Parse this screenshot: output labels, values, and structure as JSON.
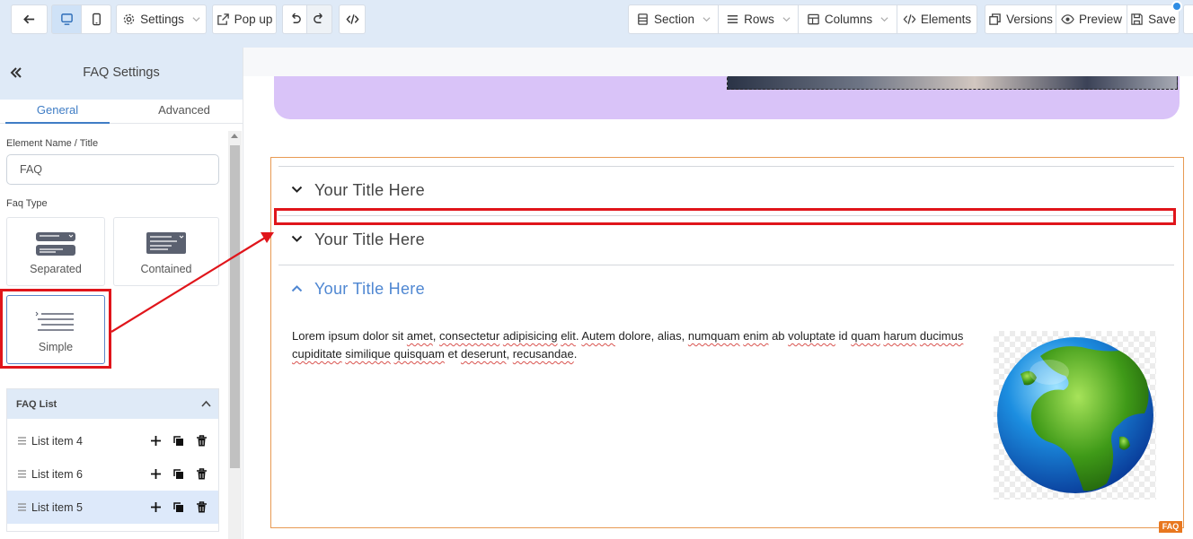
{
  "toolbar": {
    "settings_label": "Settings",
    "popup_label": "Pop up",
    "section_label": "Section",
    "rows_label": "Rows",
    "columns_label": "Columns",
    "elements_label": "Elements",
    "versions_label": "Versions",
    "preview_label": "Preview",
    "save_label": "Save"
  },
  "panel": {
    "title": "FAQ Settings",
    "tabs": [
      {
        "label": "General"
      },
      {
        "label": "Advanced"
      }
    ],
    "element_name_label": "Element Name / Title",
    "element_name_value": "FAQ",
    "faq_type_label": "Faq Type",
    "faq_types": [
      {
        "label": "Separated"
      },
      {
        "label": "Contained"
      },
      {
        "label": "Simple"
      }
    ],
    "faq_list_label": "FAQ List",
    "list_items": [
      {
        "label": "List item 4"
      },
      {
        "label": "List item 6"
      },
      {
        "label": "List item 5"
      }
    ]
  },
  "canvas": {
    "faq_items": [
      {
        "title": "Your Title Here"
      },
      {
        "title": "Your Title Here"
      },
      {
        "title": "Your Title Here"
      }
    ],
    "faq_body_parts": [
      "Lorem ipsum dolor sit ",
      "amet",
      ", ",
      "consectetur",
      " ",
      "adipisicing",
      " ",
      "elit",
      ". ",
      "Autem",
      " dolore, alias, ",
      "numquam",
      " ",
      "enim",
      " ab ",
      "voluptate",
      " id ",
      "quam",
      " ",
      "harum",
      " ",
      "ducimus",
      " ",
      "cupiditate",
      " ",
      "similique",
      " ",
      "quisquam",
      " et ",
      "deserunt",
      ", ",
      "recusandae",
      "."
    ],
    "faq_tag": "FAQ"
  },
  "colors": {
    "accent": "#3f7dc5",
    "open_title": "#4f87d2",
    "annotation": "#e0151b",
    "faq_border": "#e89a53",
    "purple_block": "#d9c3f8"
  }
}
